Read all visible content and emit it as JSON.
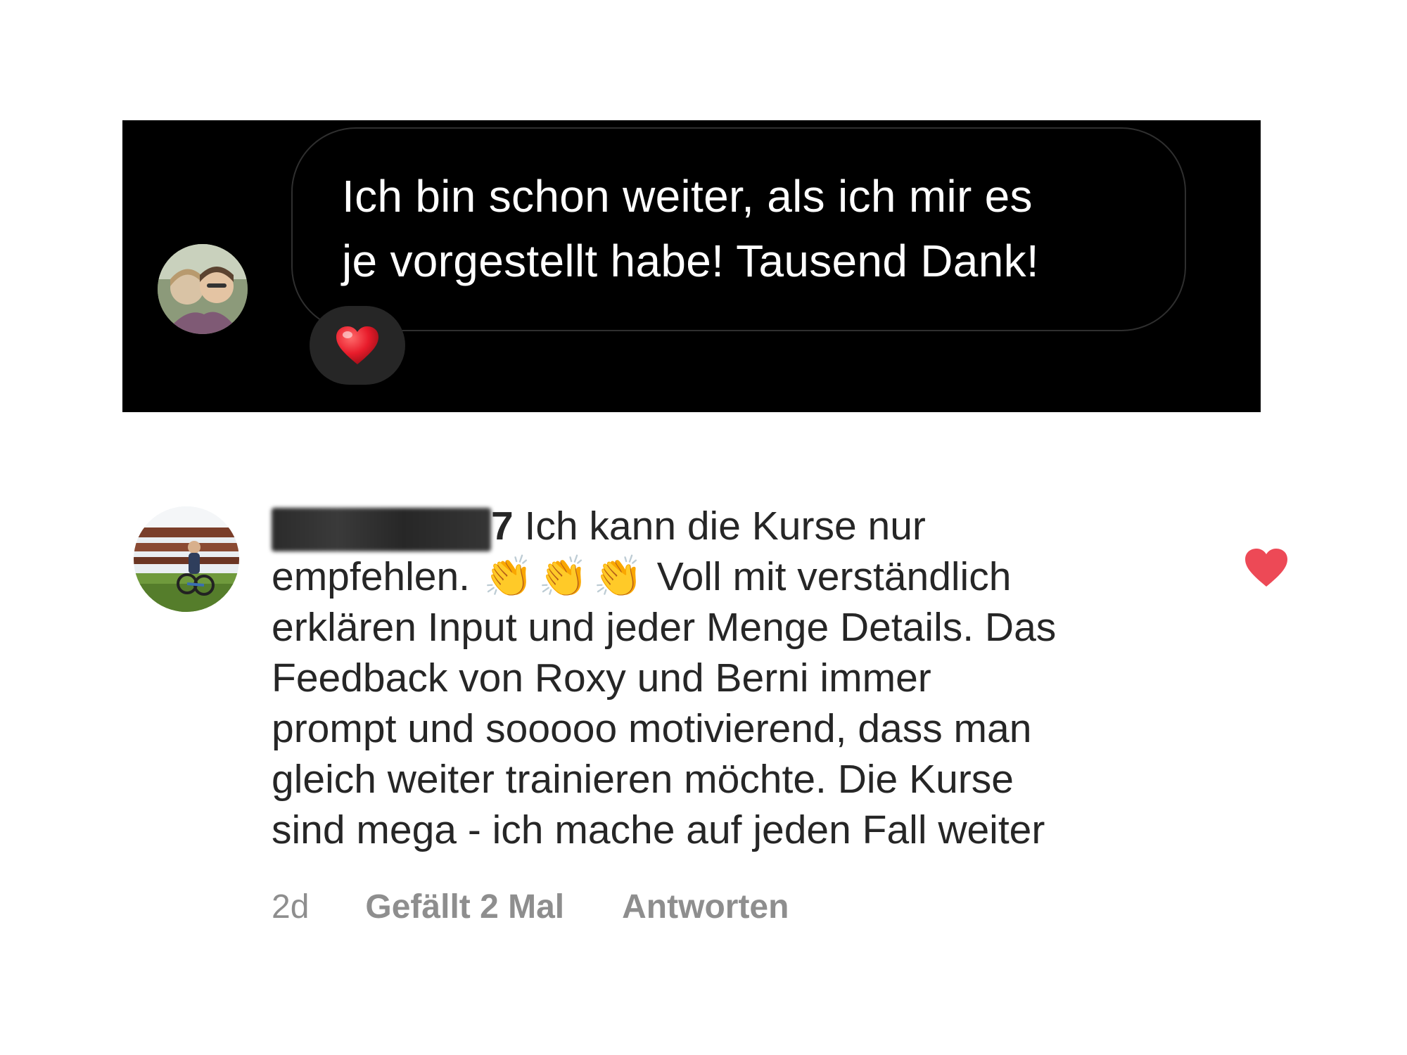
{
  "direct_message": {
    "line_1": "Ich bin schon weiter, als ich mir es",
    "line_2": "je vorgestellt habe! Tausend Dank!",
    "reaction": "❤️",
    "reaction_icon": "heart-emoji"
  },
  "comment": {
    "username_visible_suffix": "7",
    "text_line_1": "Ich kann die Kurse nur",
    "text_line_2_start": "empfehlen.",
    "claps": [
      "👏",
      "👏",
      "👏"
    ],
    "text_line_2_end": "Voll mit verständlich",
    "text_rest": [
      "erklären Input und jeder Menge Details. Das",
      "Feedback von Roxy und Berni immer",
      "prompt und sooooo motivierend, dass man",
      "gleich weiter trainieren möchte. Die Kurse",
      "sind mega - ich mache auf jeden Fall weiter"
    ],
    "time": "2d",
    "likes": "Gefällt 2 Mal",
    "reply": "Antworten",
    "liked": true,
    "heart_color": "#ed4956"
  },
  "colors": {
    "dm_background": "#000000",
    "dm_bubble_border": "#2f2f2f",
    "reaction_pill": "#262626",
    "comment_text": "#262626",
    "meta_text": "#8e8e8e"
  }
}
